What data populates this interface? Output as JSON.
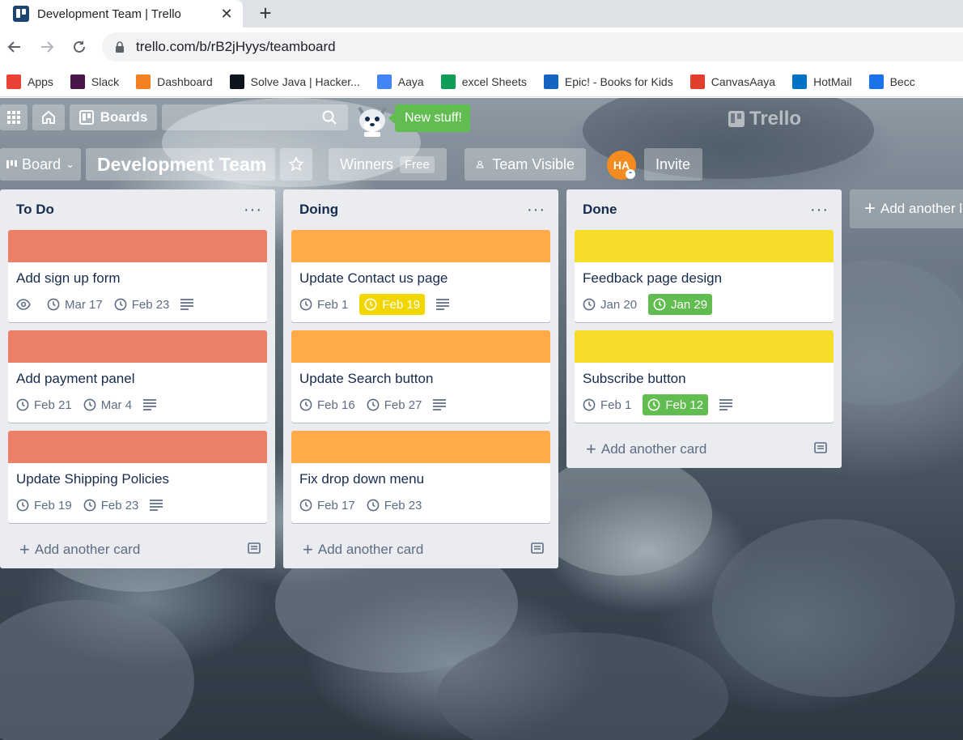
{
  "browser": {
    "tab_title": "Development Team | Trello",
    "url": "trello.com/b/rB2jHyys/teamboard",
    "bookmarks": [
      {
        "label": "Apps",
        "color": "#ea4335",
        "icon": "apps-grid-icon"
      },
      {
        "label": "Slack",
        "color": "#4a154b",
        "icon": "slack-icon"
      },
      {
        "label": "Dashboard",
        "color": "#f38020",
        "icon": "moodle-icon"
      },
      {
        "label": "Solve Java | Hacker...",
        "color": "#0e141e",
        "icon": "hackerrank-icon"
      },
      {
        "label": "Aaya",
        "color": "#4285f4",
        "icon": "google-docs-icon"
      },
      {
        "label": "excel Sheets",
        "color": "#0f9d58",
        "icon": "google-sheets-icon"
      },
      {
        "label": "Epic! - Books for Kids",
        "color": "#1565c0",
        "icon": "epic-icon"
      },
      {
        "label": "CanvasAaya",
        "color": "#e13f2b",
        "icon": "canvas-icon"
      },
      {
        "label": "HotMail",
        "color": "#0072c6",
        "icon": "outlook-icon"
      },
      {
        "label": "Becc",
        "color": "#1a73e8",
        "icon": "video-icon"
      }
    ]
  },
  "header": {
    "boards_label": "Boards",
    "new_stuff_label": "New stuff!",
    "logo_text": "Trello"
  },
  "board_header": {
    "view_label": "Board",
    "board_title": "Development Team",
    "team_name": "Winners",
    "team_plan": "Free",
    "visibility_label": "Team Visible",
    "avatar_initials": "HA",
    "invite_label": "Invite"
  },
  "colors": {
    "red_label": "#eb7f68",
    "orange_label": "#ffab4a",
    "yellow_label": "#f5dd29",
    "due_yellow": "#f2d600",
    "due_green": "#61bd4f"
  },
  "lists": [
    {
      "title": "To Do",
      "menu": "···",
      "add_card_label": "Add another card",
      "cards": [
        {
          "title": "Add sign up form",
          "cover": "red",
          "watch": true,
          "start": "Mar 17",
          "due": "Feb 23",
          "due_style": "plain",
          "description": true
        },
        {
          "title": "Add payment panel",
          "cover": "red",
          "watch": false,
          "start": "Feb 21",
          "due": "Mar 4",
          "due_style": "plain",
          "description": true
        },
        {
          "title": "Update Shipping Policies",
          "cover": "red",
          "watch": false,
          "start": "Feb 19",
          "due": "Feb 23",
          "due_style": "plain",
          "description": true
        }
      ]
    },
    {
      "title": "Doing",
      "menu": "···",
      "add_card_label": "Add another card",
      "cards": [
        {
          "title": "Update Contact us page",
          "cover": "orange",
          "watch": false,
          "start": "Feb 1",
          "due": "Feb 19",
          "due_style": "yellow",
          "description": true
        },
        {
          "title": "Update Search button",
          "cover": "orange",
          "watch": false,
          "start": "Feb 16",
          "due": "Feb 27",
          "due_style": "plain",
          "description": true
        },
        {
          "title": "Fix drop down menu",
          "cover": "orange",
          "watch": false,
          "start": "Feb 17",
          "due": "Feb 23",
          "due_style": "plain",
          "description": false
        }
      ]
    },
    {
      "title": "Done",
      "menu": "···",
      "add_card_label": "Add another card",
      "cards": [
        {
          "title": "Feedback page design",
          "cover": "yellow",
          "watch": false,
          "start": "Jan 20",
          "due": "Jan 29",
          "due_style": "green",
          "description": false
        },
        {
          "title": "Subscribe button",
          "cover": "yellow",
          "watch": false,
          "start": "Feb 1",
          "due": "Feb 12",
          "due_style": "green",
          "description": true
        }
      ]
    }
  ],
  "add_list_label": "Add another list"
}
